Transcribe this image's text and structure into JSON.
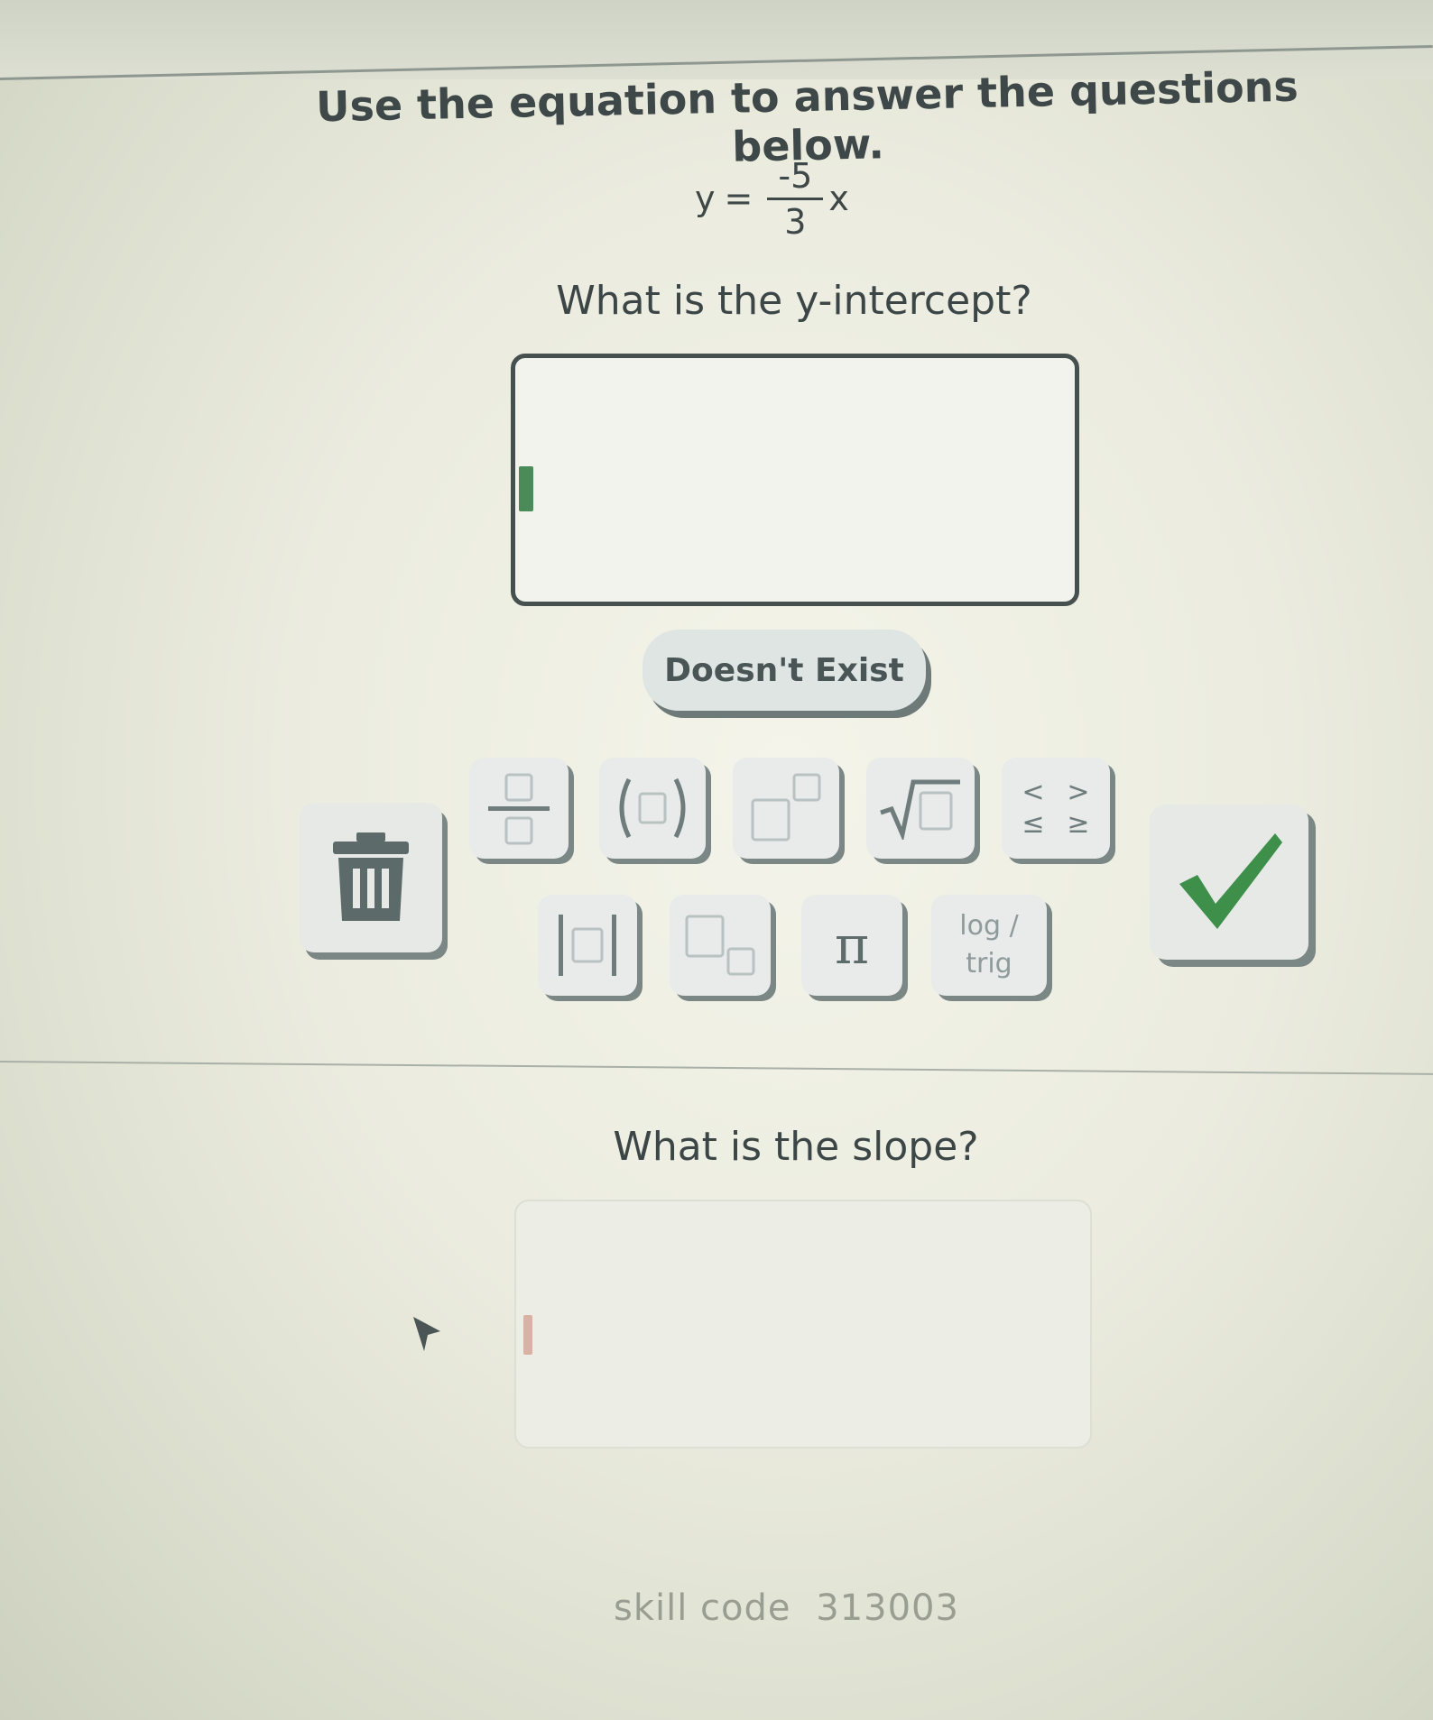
{
  "instructions": "Use the equation to answer the questions below.",
  "equation": {
    "lhs": "y",
    "equals": "=",
    "numerator": "-5",
    "denominator": "3",
    "variable": "x"
  },
  "question1": {
    "prompt": "What is the y-intercept?",
    "answer_value": ""
  },
  "doesnt_exist_label": "Doesn't Exist",
  "keypad": {
    "row1": [
      "fraction-key",
      "parentheses-key",
      "exponent-key",
      "root-key",
      "inequality-key"
    ],
    "inequality_symbols": [
      "<",
      ">",
      "≤",
      "≥"
    ],
    "pi_label": "π",
    "log_label": "log /",
    "trig_label": "trig"
  },
  "question2": {
    "prompt": "What is the slope?",
    "answer_value": ""
  },
  "footer": {
    "skill_label": "skill code",
    "skill_code": "313003"
  },
  "colors": {
    "check_green": "#3d8f4a",
    "cursor_green": "#4a8b59",
    "key_face": "#e8ebea",
    "key_shadow": "#7a8785"
  }
}
